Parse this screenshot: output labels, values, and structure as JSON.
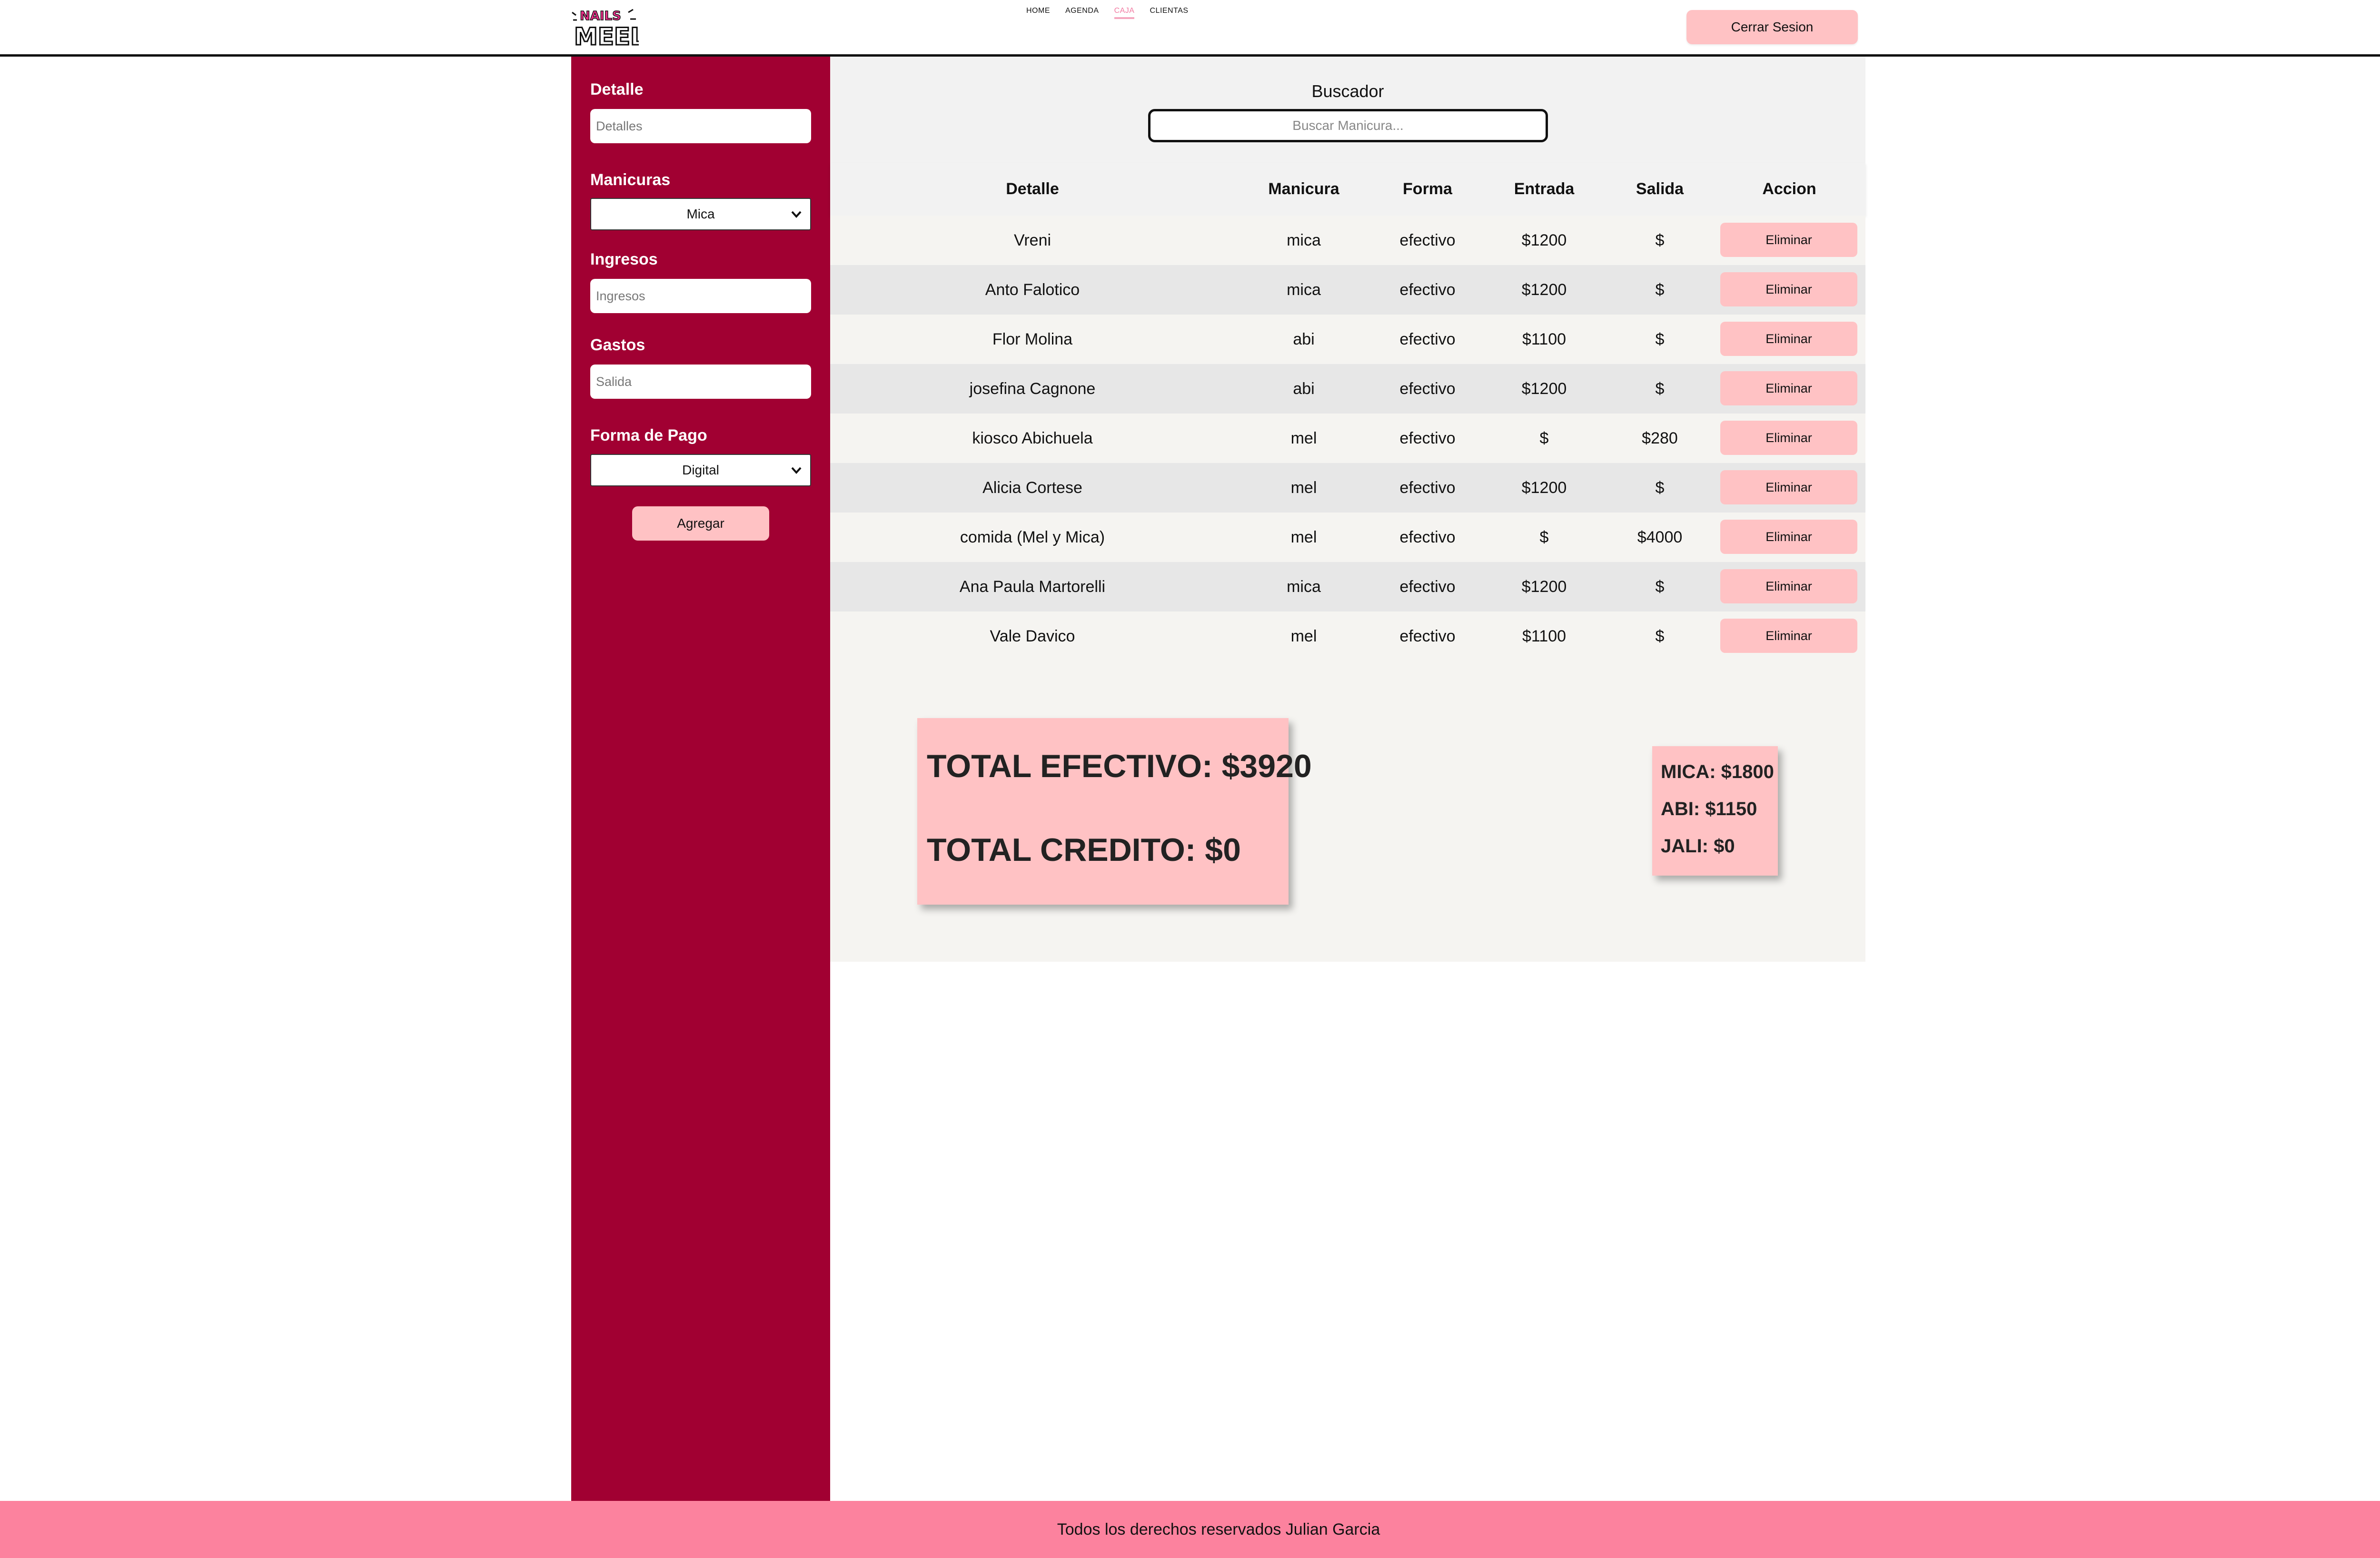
{
  "header": {
    "logo_text_top": "NAILS",
    "logo_text_bottom": "MEEL",
    "nav": [
      {
        "label": "HOME"
      },
      {
        "label": "AGENDA"
      },
      {
        "label": "CAJA"
      },
      {
        "label": "CLIENTAS"
      }
    ],
    "active_nav": "CAJA",
    "logout_label": "Cerrar Sesion"
  },
  "sidebar": {
    "detalle_label": "Detalle",
    "detalle_placeholder": "Detalles",
    "manicuras_label": "Manicuras",
    "manicuras_selected": "Mica",
    "ingresos_label": "Ingresos",
    "ingresos_placeholder": "Ingresos",
    "gastos_label": "Gastos",
    "gastos_placeholder": "Salida",
    "forma_pago_label": "Forma de Pago",
    "forma_pago_selected": "Digital",
    "add_label": "Agregar"
  },
  "search": {
    "title": "Buscador",
    "placeholder": "Buscar Manicura..."
  },
  "table": {
    "headers": [
      "Detalle",
      "Manicura",
      "Forma",
      "Entrada",
      "Salida",
      "Accion"
    ],
    "delete_label": "Eliminar",
    "rows": [
      {
        "detalle": "Vreni",
        "manicura": "mica",
        "forma": "efectivo",
        "entrada": "$1200",
        "salida": "$"
      },
      {
        "detalle": "Anto Falotico",
        "manicura": "mica",
        "forma": "efectivo",
        "entrada": "$1200",
        "salida": "$"
      },
      {
        "detalle": "Flor Molina",
        "manicura": "abi",
        "forma": "efectivo",
        "entrada": "$1100",
        "salida": "$"
      },
      {
        "detalle": "josefina Cagnone",
        "manicura": "abi",
        "forma": "efectivo",
        "entrada": "$1200",
        "salida": "$"
      },
      {
        "detalle": "kiosco Abichuela",
        "manicura": "mel",
        "forma": "efectivo",
        "entrada": "$",
        "salida": "$280"
      },
      {
        "detalle": "Alicia Cortese",
        "manicura": "mel",
        "forma": "efectivo",
        "entrada": "$1200",
        "salida": "$"
      },
      {
        "detalle": "comida (Mel y Mica)",
        "manicura": "mel",
        "forma": "efectivo",
        "entrada": "$",
        "salida": "$4000"
      },
      {
        "detalle": "Ana Paula Martorelli",
        "manicura": "mica",
        "forma": "efectivo",
        "entrada": "$1200",
        "salida": "$"
      },
      {
        "detalle": "Vale Davico",
        "manicura": "mel",
        "forma": "efectivo",
        "entrada": "$1100",
        "salida": "$"
      }
    ]
  },
  "totals": {
    "efectivo": "TOTAL EFECTIVO: $3920",
    "credito": "TOTAL CREDITO: $0"
  },
  "staff_totals": {
    "mica": "MICA: $1800",
    "abi": "ABI: $1150",
    "jali": "JALI: $0"
  },
  "footer": {
    "text": "Todos los derechos reservados Julian Garcia"
  },
  "colors": {
    "sidebar": "#a10032",
    "accent_pink": "#ffc2c4",
    "footer": "#fc829e",
    "nav_active": "#f17aa1"
  }
}
